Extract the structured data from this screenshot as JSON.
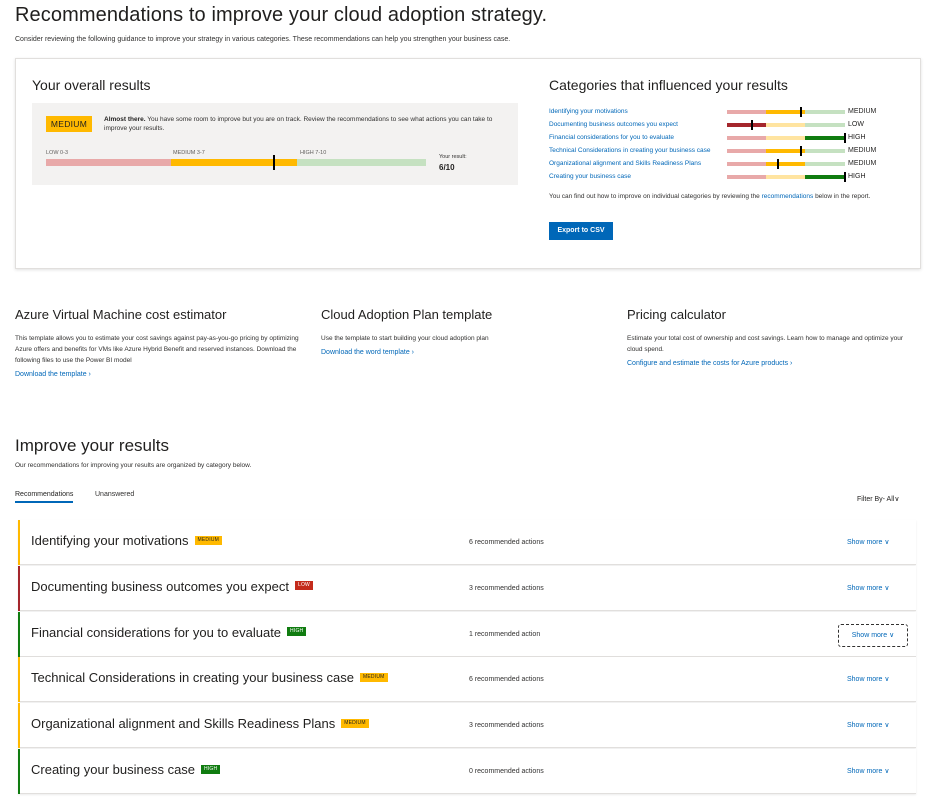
{
  "header": {
    "title": "Recommendations to improve your cloud adoption strategy.",
    "subtitle": "Consider reviewing the following guidance to improve your strategy in various categories. These recommendations can help you strengthen your business case."
  },
  "overall": {
    "title": "Your overall results",
    "level": "MEDIUM",
    "message_bold": "Almost there.",
    "message": " You have some room to improve but you are on track. Review the recommendations to see what actions you can take to improve your results.",
    "ranges": {
      "low": "LOW 0-3",
      "medium": "MEDIUM 3-7",
      "high": "HIGH 7-10"
    },
    "result_label": "Your result:",
    "result_value": "6/10",
    "score": 6,
    "scale_max": 10,
    "colors": {
      "low": "#e8a9a9",
      "medium": "#ffb900",
      "high": "#c5e1c1"
    }
  },
  "categories": {
    "title": "Categories that influenced your results",
    "items": [
      {
        "name": "Identifying your motivations",
        "level": "MEDIUM",
        "score": 0.62
      },
      {
        "name": "Documenting business outcomes you expect",
        "level": "LOW",
        "score": 0.2
      },
      {
        "name": "Financial considerations for you to evaluate",
        "level": "HIGH",
        "score": 0.99
      },
      {
        "name": "Technical Considerations in creating your business case",
        "level": "MEDIUM",
        "score": 0.62
      },
      {
        "name": "Organizational alignment and Skills Readiness Plans",
        "level": "MEDIUM",
        "score": 0.42
      },
      {
        "name": "Creating your business case",
        "level": "HIGH",
        "score": 0.99
      }
    ],
    "note_pre": "You can find out how to improve on individual categories by reviewing the ",
    "note_link": "recommendations",
    "note_post": " below in the report.",
    "export_label": "Export to CSV"
  },
  "tools": [
    {
      "title": "Azure Virtual Machine cost estimator",
      "desc": "This template allows you to estimate your cost savings against pay-as-you-go pricing by optimizing Azure offers and benefits for VMs like Azure Hybrid Benefit and reserved instances. Download the following files to use the Power BI model",
      "link": "Download the template  ›"
    },
    {
      "title": "Cloud Adoption Plan template",
      "desc": "Use the template to start building your cloud adoption plan",
      "link": "Download the word template  ›"
    },
    {
      "title": "Pricing calculator",
      "desc": "Estimate your total cost of ownership and cost savings. Learn how to manage and optimize your cloud spend.",
      "link": "Configure and estimate the costs for Azure products  ›"
    }
  ],
  "improve": {
    "title": "Improve your results",
    "subtitle": "Our recommendations for improving your results are organized by category below.",
    "tabs": [
      "Recommendations",
      "Unanswered"
    ],
    "filter_label": "Filter By- All∨",
    "show_more_label": "Show more ∨",
    "rows": [
      {
        "title": "Identifying your motivations",
        "badge": "MEDIUM",
        "count": "6 recommended actions"
      },
      {
        "title": "Documenting business outcomes you expect",
        "badge": "LOW",
        "count": "3 recommended actions"
      },
      {
        "title": "Financial considerations for you to evaluate",
        "badge": "HIGH",
        "count": "1 recommended action"
      },
      {
        "title": "Technical Considerations in creating your business case",
        "badge": "MEDIUM",
        "count": "6 recommended actions"
      },
      {
        "title": "Organizational alignment and Skills Readiness Plans",
        "badge": "MEDIUM",
        "count": "3 recommended actions"
      },
      {
        "title": "Creating your business case",
        "badge": "HIGH",
        "count": "0 recommended actions"
      }
    ]
  },
  "level_colors": {
    "MEDIUM": "#ffb900",
    "LOW": "#c42b1c",
    "HIGH": "#107c10"
  }
}
